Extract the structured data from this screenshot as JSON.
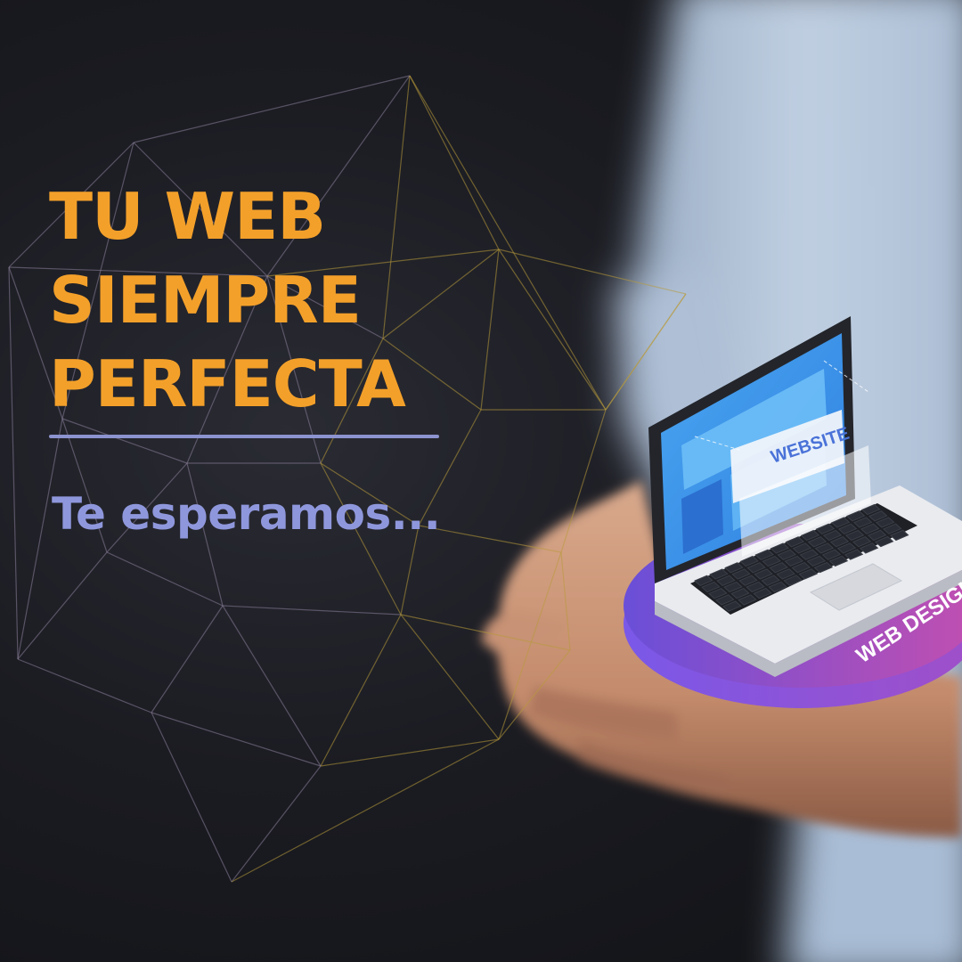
{
  "headline": {
    "lines": [
      "TU WEB",
      "SIEMPRE",
      "PERFECTA"
    ],
    "color": "#f3a02a"
  },
  "tagline": {
    "text": "Te esperamos...",
    "color": "#8f97dc"
  },
  "illustration": {
    "screen_label": "WEBSITE",
    "platform_label": "WEB DESIGN",
    "platform_colors": [
      "#6a4fd8",
      "#c24fb0"
    ]
  },
  "icons": {
    "background": "polygon-network-icon",
    "device": "laptop-icon"
  }
}
